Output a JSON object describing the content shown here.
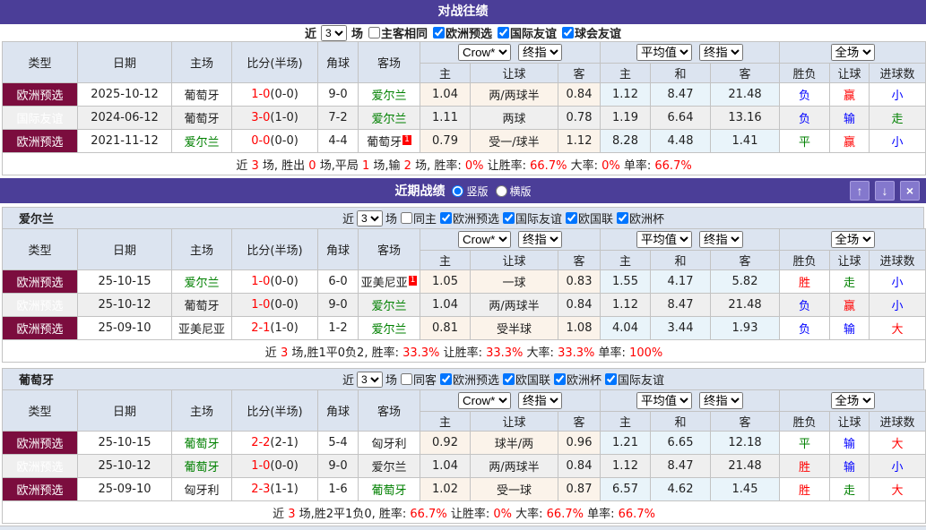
{
  "colors": {
    "titlebar_purple": "#4b3e98",
    "button_purple": "#8478cd",
    "type_maroon": "#7b0d3e",
    "type_blue": "#5b7ac5",
    "header_bg": "#dce4f0",
    "odds_cream_bg": "#fbf3ea",
    "avg_blue_bg": "#e9f4fa",
    "win_red": "#f00",
    "lose_blue": "#00f",
    "draw_green": "#008000"
  },
  "table_headers": {
    "main": [
      "类型",
      "日期",
      "主场",
      "比分(半场)",
      "角球",
      "客场"
    ],
    "sub": [
      "主",
      "让球",
      "客",
      "主",
      "和",
      "客",
      "胜负",
      "让球",
      "进球数"
    ],
    "selects": {
      "book": "Crow*",
      "final": "终指",
      "avg": "平均值",
      "final2": "终指",
      "full": "全场"
    }
  },
  "h2h": {
    "title": "对战往绩",
    "filter": {
      "prefix": "近",
      "count": "3",
      "suffix": "场",
      "checks": [
        {
          "label": "主客相同",
          "on": false
        },
        {
          "label": "欧洲预选",
          "on": true
        },
        {
          "label": "国际友谊",
          "on": true
        },
        {
          "label": "球会友谊",
          "on": true
        }
      ]
    },
    "rows": [
      {
        "type": "欧洲预选",
        "type_cls": "type-maroon",
        "date": "2025-10-12",
        "home": "葡萄牙",
        "home_cls": "c-dark",
        "home_badge": "",
        "score": "1-0",
        "half": "(0-0)",
        "corner": "9-0",
        "away": "爱尔兰",
        "away_cls": "c-green",
        "away_badge": "",
        "odds": [
          "1.04",
          "两/两球半",
          "0.84"
        ],
        "avg": [
          "1.12",
          "8.47",
          "21.48"
        ],
        "res": [
          {
            "t": "负",
            "c": "c-blue"
          },
          {
            "t": "赢",
            "c": "c-red"
          },
          {
            "t": "小",
            "c": "c-blue"
          }
        ]
      },
      {
        "type": "国际友谊",
        "type_cls": "type-blue",
        "date": "2024-06-12",
        "home": "葡萄牙",
        "home_cls": "c-dark",
        "home_badge": "",
        "score": "3-0",
        "half": "(1-0)",
        "corner": "7-2",
        "away": "爱尔兰",
        "away_cls": "c-green",
        "away_badge": "",
        "odds": [
          "1.11",
          "两球",
          "0.78"
        ],
        "avg": [
          "1.19",
          "6.64",
          "13.16"
        ],
        "res": [
          {
            "t": "负",
            "c": "c-blue"
          },
          {
            "t": "输",
            "c": "c-blue"
          },
          {
            "t": "走",
            "c": "c-green"
          }
        ]
      },
      {
        "type": "欧洲预选",
        "type_cls": "type-maroon",
        "date": "2021-11-12",
        "home": "爱尔兰",
        "home_cls": "c-green",
        "home_badge": "",
        "score": "0-0",
        "half": "(0-0)",
        "corner": "4-4",
        "away": "葡萄牙",
        "away_cls": "c-dark",
        "away_badge": "1",
        "odds": [
          "0.79",
          "受一/球半",
          "1.12"
        ],
        "avg": [
          "8.28",
          "4.48",
          "1.41"
        ],
        "res": [
          {
            "t": "平",
            "c": "c-green"
          },
          {
            "t": "赢",
            "c": "c-red"
          },
          {
            "t": "小",
            "c": "c-blue"
          }
        ]
      }
    ],
    "summary": [
      {
        "t": "近 ",
        "c": ""
      },
      {
        "t": "3",
        "c": "c-red"
      },
      {
        "t": " 场, 胜出 ",
        "c": ""
      },
      {
        "t": "0",
        "c": "c-red"
      },
      {
        "t": " 场,平局 ",
        "c": ""
      },
      {
        "t": "1",
        "c": "c-red"
      },
      {
        "t": " 场,输 ",
        "c": ""
      },
      {
        "t": "2",
        "c": "c-red"
      },
      {
        "t": " 场, 胜率: ",
        "c": ""
      },
      {
        "t": "0%",
        "c": "c-red"
      },
      {
        "t": " 让胜率: ",
        "c": ""
      },
      {
        "t": "66.7%",
        "c": "c-red"
      },
      {
        "t": " 大率: ",
        "c": ""
      },
      {
        "t": "0%",
        "c": "c-red"
      },
      {
        "t": " 单率: ",
        "c": ""
      },
      {
        "t": "66.7%",
        "c": "c-red"
      }
    ]
  },
  "recent": {
    "title": "近期战绩",
    "views": [
      {
        "label": "竖版",
        "on": true
      },
      {
        "label": "横版",
        "on": false
      }
    ],
    "buttons": {
      "up": "↑",
      "down": "↓",
      "close": "×"
    },
    "sections": [
      {
        "team": "爱尔兰",
        "filter": {
          "prefix": "近",
          "count": "3",
          "suffix": "场",
          "checks": [
            {
              "label": "同主",
              "on": false
            },
            {
              "label": "欧洲预选",
              "on": true
            },
            {
              "label": "国际友谊",
              "on": true
            },
            {
              "label": "欧国联",
              "on": true
            },
            {
              "label": "欧洲杯",
              "on": true
            }
          ]
        },
        "rows": [
          {
            "type": "欧洲预选",
            "type_cls": "type-maroon",
            "date": "25-10-15",
            "home": "爱尔兰",
            "home_cls": "c-green",
            "home_badge": "",
            "score": "1-0",
            "half": "(0-0)",
            "corner": "6-0",
            "away": "亚美尼亚",
            "away_cls": "c-dark",
            "away_badge": "1",
            "odds": [
              "1.05",
              "一球",
              "0.83"
            ],
            "avg": [
              "1.55",
              "4.17",
              "5.82"
            ],
            "res": [
              {
                "t": "胜",
                "c": "c-red"
              },
              {
                "t": "走",
                "c": "c-green"
              },
              {
                "t": "小",
                "c": "c-blue"
              }
            ]
          },
          {
            "type": "欧洲预选",
            "type_cls": "type-maroon",
            "date": "25-10-12",
            "home": "葡萄牙",
            "home_cls": "c-dark",
            "home_badge": "",
            "score": "1-0",
            "half": "(0-0)",
            "corner": "9-0",
            "away": "爱尔兰",
            "away_cls": "c-green",
            "away_badge": "",
            "odds": [
              "1.04",
              "两/两球半",
              "0.84"
            ],
            "avg": [
              "1.12",
              "8.47",
              "21.48"
            ],
            "res": [
              {
                "t": "负",
                "c": "c-blue"
              },
              {
                "t": "赢",
                "c": "c-red"
              },
              {
                "t": "小",
                "c": "c-blue"
              }
            ]
          },
          {
            "type": "欧洲预选",
            "type_cls": "type-maroon",
            "date": "25-09-10",
            "home": "亚美尼亚",
            "home_cls": "c-dark",
            "home_badge": "",
            "score": "2-1",
            "half": "(1-0)",
            "corner": "1-2",
            "away": "爱尔兰",
            "away_cls": "c-green",
            "away_badge": "",
            "odds": [
              "0.81",
              "受半球",
              "1.08"
            ],
            "avg": [
              "4.04",
              "3.44",
              "1.93"
            ],
            "res": [
              {
                "t": "负",
                "c": "c-blue"
              },
              {
                "t": "输",
                "c": "c-blue"
              },
              {
                "t": "大",
                "c": "c-red"
              }
            ]
          }
        ],
        "summary": [
          {
            "t": "近",
            "c": ""
          },
          {
            "t": "3",
            "c": "c-red"
          },
          {
            "t": "场,胜1平0负2, 胜率:",
            "c": ""
          },
          {
            "t": "33.3%",
            "c": "c-red"
          },
          {
            "t": " 让胜率:",
            "c": ""
          },
          {
            "t": "33.3%",
            "c": "c-red"
          },
          {
            "t": " 大率:",
            "c": ""
          },
          {
            "t": "33.3%",
            "c": "c-red"
          },
          {
            "t": " 单率:",
            "c": ""
          },
          {
            "t": "100%",
            "c": "c-red"
          }
        ]
      },
      {
        "team": "葡萄牙",
        "filter": {
          "prefix": "近",
          "count": "3",
          "suffix": "场",
          "checks": [
            {
              "label": "同客",
              "on": false
            },
            {
              "label": "欧洲预选",
              "on": true
            },
            {
              "label": "欧国联",
              "on": true
            },
            {
              "label": "欧洲杯",
              "on": true
            },
            {
              "label": "国际友谊",
              "on": true
            }
          ]
        },
        "rows": [
          {
            "type": "欧洲预选",
            "type_cls": "type-maroon",
            "date": "25-10-15",
            "home": "葡萄牙",
            "home_cls": "c-green",
            "home_badge": "",
            "score": "2-2",
            "half": "(2-1)",
            "corner": "5-4",
            "away": "匈牙利",
            "away_cls": "c-dark",
            "away_badge": "",
            "odds": [
              "0.92",
              "球半/两",
              "0.96"
            ],
            "avg": [
              "1.21",
              "6.65",
              "12.18"
            ],
            "res": [
              {
                "t": "平",
                "c": "c-green"
              },
              {
                "t": "输",
                "c": "c-blue"
              },
              {
                "t": "大",
                "c": "c-red"
              }
            ]
          },
          {
            "type": "欧洲预选",
            "type_cls": "type-maroon",
            "date": "25-10-12",
            "home": "葡萄牙",
            "home_cls": "c-green",
            "home_badge": "",
            "score": "1-0",
            "half": "(0-0)",
            "corner": "9-0",
            "away": "爱尔兰",
            "away_cls": "c-dark",
            "away_badge": "",
            "odds": [
              "1.04",
              "两/两球半",
              "0.84"
            ],
            "avg": [
              "1.12",
              "8.47",
              "21.48"
            ],
            "res": [
              {
                "t": "胜",
                "c": "c-red"
              },
              {
                "t": "输",
                "c": "c-blue"
              },
              {
                "t": "小",
                "c": "c-blue"
              }
            ]
          },
          {
            "type": "欧洲预选",
            "type_cls": "type-maroon",
            "date": "25-09-10",
            "home": "匈牙利",
            "home_cls": "c-dark",
            "home_badge": "",
            "score": "2-3",
            "half": "(1-1)",
            "corner": "1-6",
            "away": "葡萄牙",
            "away_cls": "c-green",
            "away_badge": "",
            "odds": [
              "1.02",
              "受一球",
              "0.87"
            ],
            "avg": [
              "6.57",
              "4.62",
              "1.45"
            ],
            "res": [
              {
                "t": "胜",
                "c": "c-red"
              },
              {
                "t": "走",
                "c": "c-green"
              },
              {
                "t": "大",
                "c": "c-red"
              }
            ]
          }
        ],
        "summary": [
          {
            "t": "近",
            "c": ""
          },
          {
            "t": "3",
            "c": "c-red"
          },
          {
            "t": "场,胜2平1负0, 胜率:",
            "c": ""
          },
          {
            "t": "66.7%",
            "c": "c-red"
          },
          {
            "t": " 让胜率:",
            "c": ""
          },
          {
            "t": "0%",
            "c": "c-red"
          },
          {
            "t": " 大率:",
            "c": ""
          },
          {
            "t": "66.7%",
            "c": "c-red"
          },
          {
            "t": " 单率:",
            "c": ""
          },
          {
            "t": "66.7%",
            "c": "c-red"
          }
        ]
      }
    ]
  }
}
